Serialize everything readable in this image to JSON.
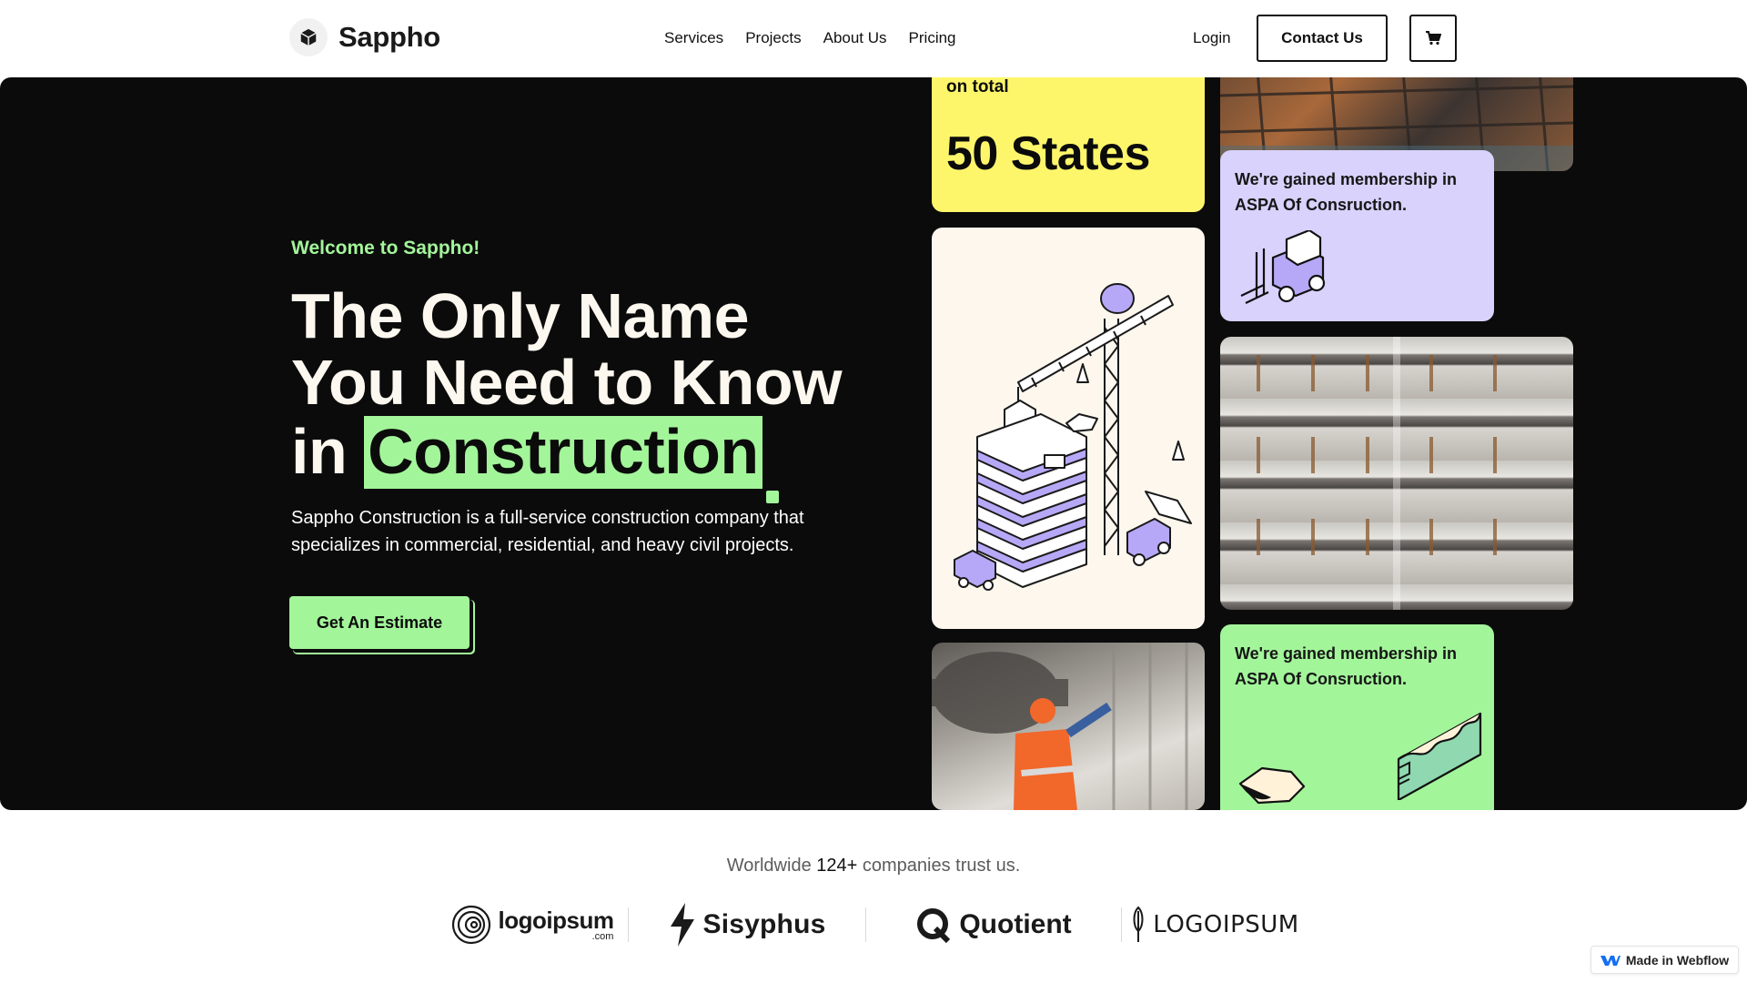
{
  "nav": {
    "brand": "Sappho",
    "links": [
      "Services",
      "Projects",
      "About Us",
      "Pricing"
    ],
    "login": "Login",
    "contact": "Contact Us"
  },
  "hero": {
    "welcome": "Welcome to Sappho!",
    "headline_line1": "The Only Name",
    "headline_line2": "You Need to Know",
    "headline_line3_prefix": "in",
    "headline_highlight": "Construction",
    "subtext": "Sappho Construction is a full-service construction company that specializes in commercial, residential, and heavy civil projects.",
    "cta": "Get An Estimate"
  },
  "cards": {
    "yellow_small": "on total",
    "yellow_big": "50 States",
    "purple_text": "We're gained membership  in ASPA Of Consruction.",
    "green_text": "We're gained membership  in ASPA Of Consruction."
  },
  "trust": {
    "prefix": "Worldwide",
    "count": "124+",
    "suffix": "companies trust us."
  },
  "logos": {
    "logo1": "logoipsum",
    "logo1_sub": ".com",
    "logo2": "Sisyphus",
    "logo3": "Quotient",
    "logo4": "LOGOIPSUM"
  },
  "badge": "Made in Webflow",
  "colors": {
    "accent_green": "#a3f59a",
    "accent_yellow": "#fdf66b",
    "accent_purple": "#d8d2fc",
    "hero_bg": "#0b0b0b"
  }
}
